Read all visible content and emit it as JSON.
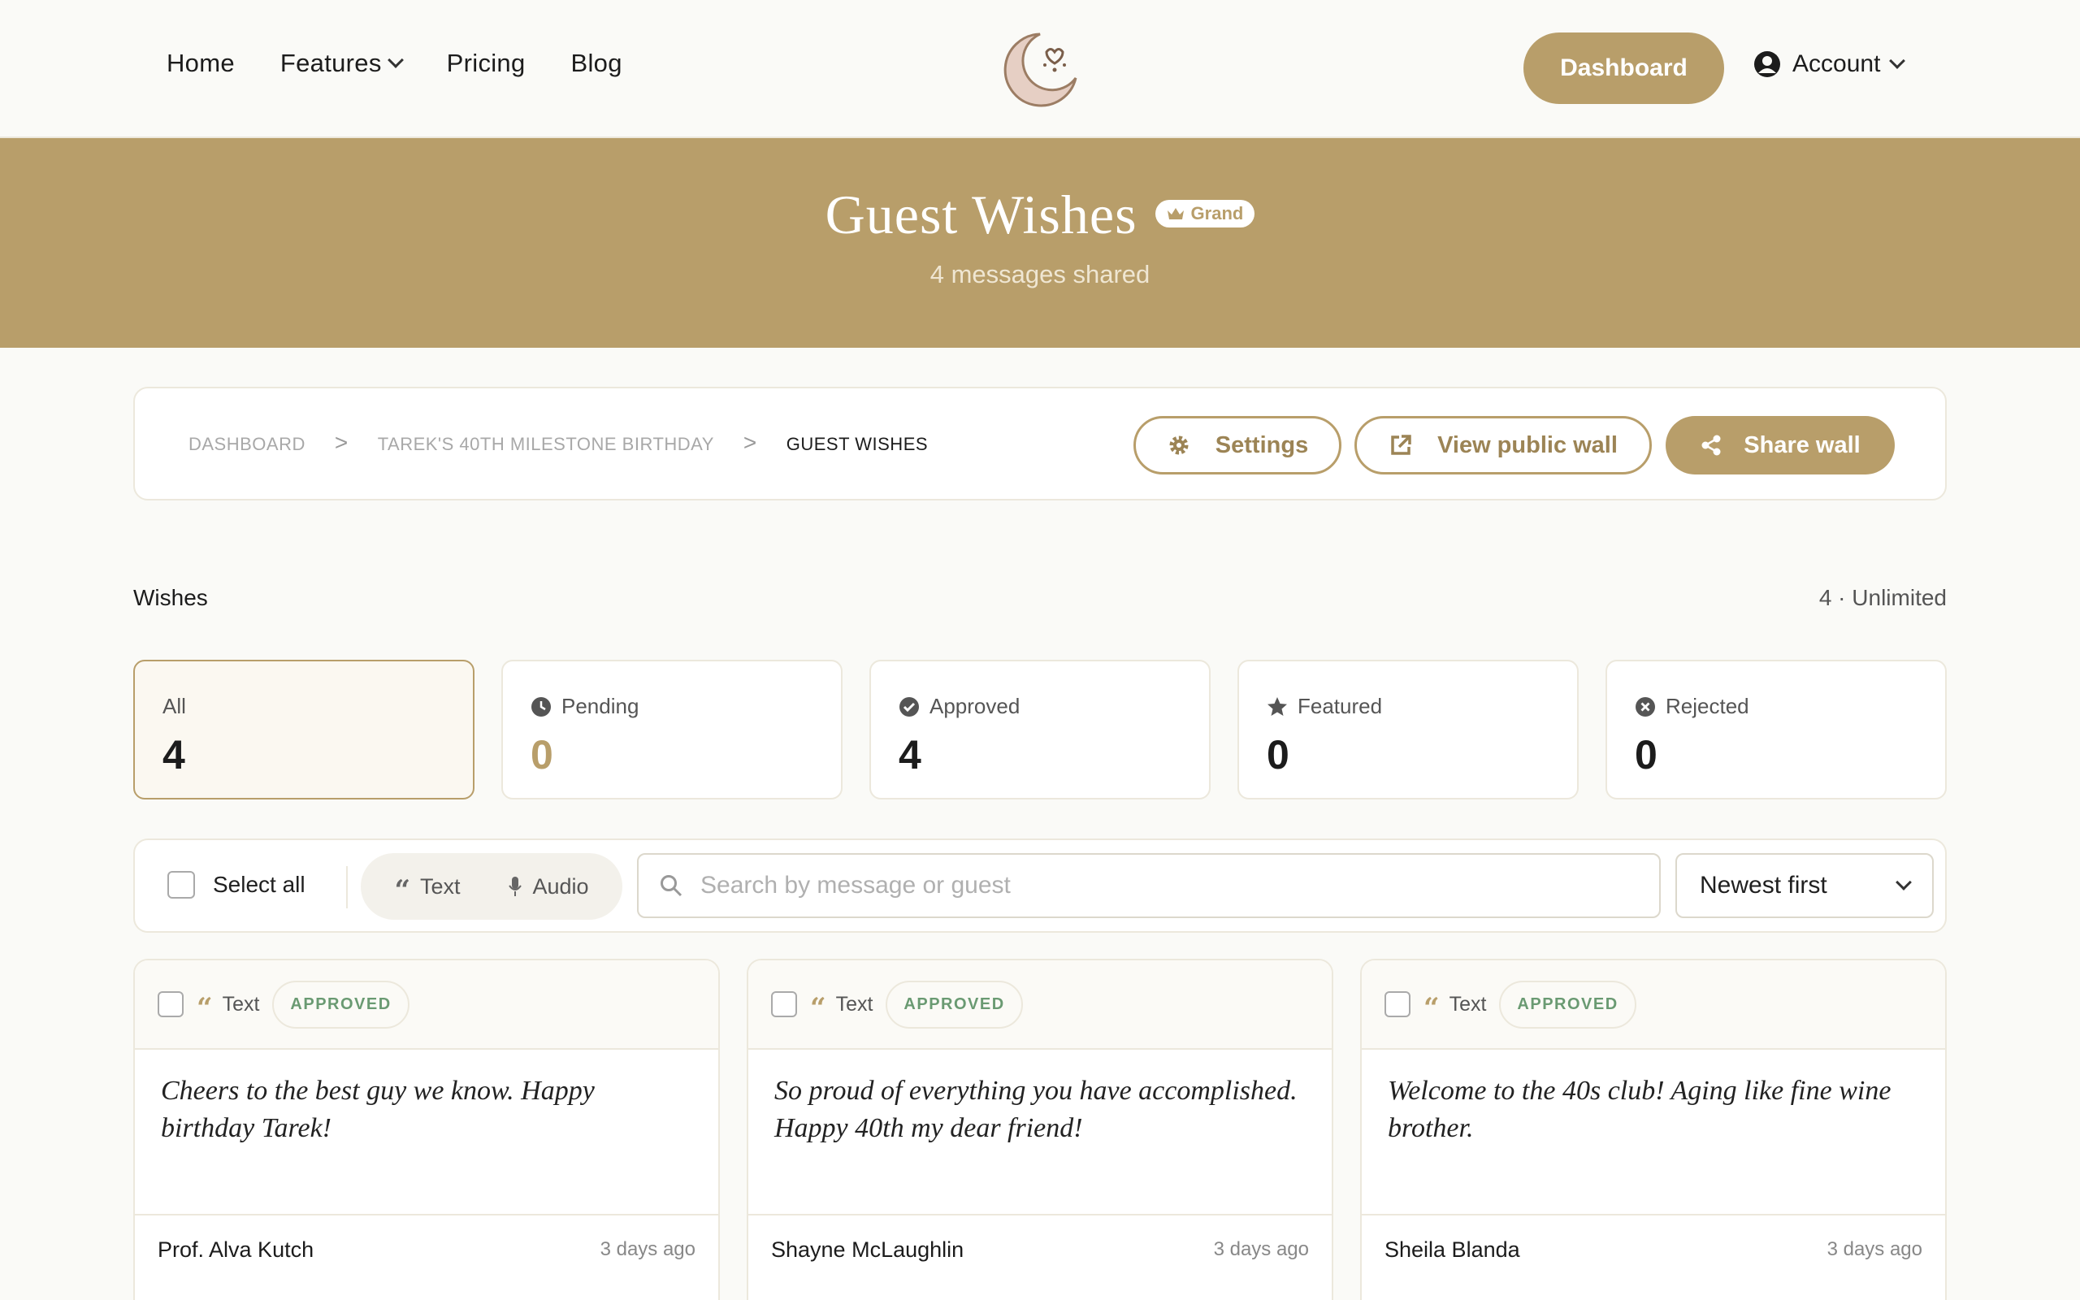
{
  "nav": {
    "links": [
      "Home",
      "Features",
      "Pricing",
      "Blog"
    ],
    "dashboard_label": "Dashboard",
    "account_label": "Account"
  },
  "hero": {
    "title": "Guest Wishes",
    "badge": "Grand",
    "subtitle": "4 messages shared"
  },
  "breadcrumb": {
    "items": [
      "DASHBOARD",
      "TAREK'S 40TH MILESTONE BIRTHDAY",
      "GUEST WISHES"
    ],
    "separator": ">"
  },
  "actions": {
    "settings": "Settings",
    "view_public": "View public wall",
    "share": "Share wall"
  },
  "wishes_header": {
    "label": "Wishes",
    "count": "4 · Unlimited"
  },
  "stats": [
    {
      "label": "All",
      "value": "4"
    },
    {
      "label": "Pending",
      "value": "0"
    },
    {
      "label": "Approved",
      "value": "4"
    },
    {
      "label": "Featured",
      "value": "0"
    },
    {
      "label": "Rejected",
      "value": "0"
    }
  ],
  "toolbar": {
    "select_all": "Select all",
    "type_text": "Text",
    "type_audio": "Audio",
    "search_placeholder": "Search by message or guest",
    "sort_value": "Newest first"
  },
  "wishes": [
    {
      "type": "Text",
      "status": "APPROVED",
      "message": "Cheers to the best guy we know. Happy birthday Tarek!",
      "author": "Prof. Alva Kutch",
      "time": "3 days ago"
    },
    {
      "type": "Text",
      "status": "APPROVED",
      "message": "So proud of everything you have accomplished. Happy 40th my dear friend!",
      "author": "Shayne McLaughlin",
      "time": "3 days ago"
    },
    {
      "type": "Text",
      "status": "APPROVED",
      "message": "Welcome to the 40s club! Aging like fine wine brother.",
      "author": "Sheila Blanda",
      "time": "3 days ago"
    }
  ],
  "colors": {
    "brand": "#b89e6a",
    "approved": "#6a9a72",
    "background": "#fafaf7"
  }
}
